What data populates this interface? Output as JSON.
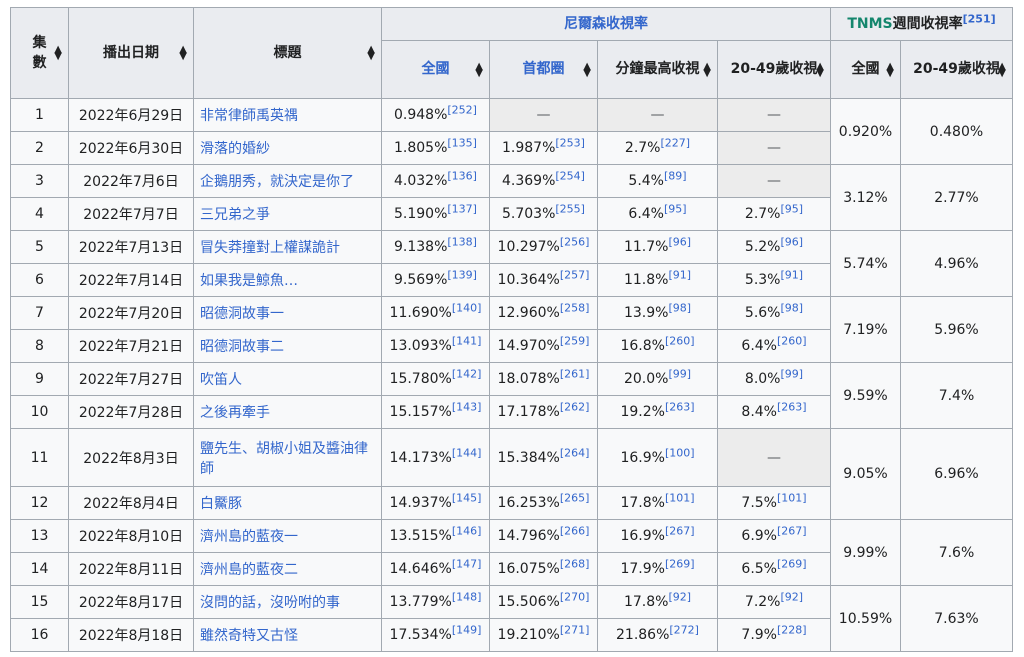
{
  "headers": {
    "ep": "集數",
    "date": "播出日期",
    "title": "標題",
    "nielsen_group": "尼爾森收視率",
    "tnms_group": "TNMS週間收視率",
    "tnms_ref": "[251]",
    "n_national": "全國",
    "n_capital": "首都圈",
    "n_peak": "分鐘最高收視",
    "n_2049": "20-49歲收視",
    "t_national": "全國",
    "t_2049": "20-49歲收視"
  },
  "rows": [
    {
      "ep": "1",
      "date": "2022年6月29日",
      "title": "非常律師禹英禑",
      "nat": "0.948%",
      "nat_ref": "[252]",
      "cap": "—",
      "cap_ref": "",
      "peak": "—",
      "peak_ref": "",
      "y2049": "—",
      "y2049_ref": ""
    },
    {
      "ep": "2",
      "date": "2022年6月30日",
      "title": "滑落的婚紗",
      "nat": "1.805%",
      "nat_ref": "[135]",
      "cap": "1.987%",
      "cap_ref": "[253]",
      "peak": "2.7%",
      "peak_ref": "[227]",
      "y2049": "—",
      "y2049_ref": ""
    },
    {
      "ep": "3",
      "date": "2022年7月6日",
      "title": "企鵝朋秀，就決定是你了",
      "nat": "4.032%",
      "nat_ref": "[136]",
      "cap": "4.369%",
      "cap_ref": "[254]",
      "peak": "5.4%",
      "peak_ref": "[89]",
      "y2049": "—",
      "y2049_ref": ""
    },
    {
      "ep": "4",
      "date": "2022年7月7日",
      "title": "三兄弟之爭",
      "nat": "5.190%",
      "nat_ref": "[137]",
      "cap": "5.703%",
      "cap_ref": "[255]",
      "peak": "6.4%",
      "peak_ref": "[95]",
      "y2049": "2.7%",
      "y2049_ref": "[95]"
    },
    {
      "ep": "5",
      "date": "2022年7月13日",
      "title": "冒失莽撞對上權謀詭計",
      "nat": "9.138%",
      "nat_ref": "[138]",
      "cap": "10.297%",
      "cap_ref": "[256]",
      "peak": "11.7%",
      "peak_ref": "[96]",
      "y2049": "5.2%",
      "y2049_ref": "[96]"
    },
    {
      "ep": "6",
      "date": "2022年7月14日",
      "title": "如果我是鯨魚…",
      "nat": "9.569%",
      "nat_ref": "[139]",
      "cap": "10.364%",
      "cap_ref": "[257]",
      "peak": "11.8%",
      "peak_ref": "[91]",
      "y2049": "5.3%",
      "y2049_ref": "[91]"
    },
    {
      "ep": "7",
      "date": "2022年7月20日",
      "title": "昭德洞故事一",
      "nat": "11.690%",
      "nat_ref": "[140]",
      "cap": "12.960%",
      "cap_ref": "[258]",
      "peak": "13.9%",
      "peak_ref": "[98]",
      "y2049": "5.6%",
      "y2049_ref": "[98]"
    },
    {
      "ep": "8",
      "date": "2022年7月21日",
      "title": "昭德洞故事二",
      "nat": "13.093%",
      "nat_ref": "[141]",
      "cap": "14.970%",
      "cap_ref": "[259]",
      "peak": "16.8%",
      "peak_ref": "[260]",
      "y2049": "6.4%",
      "y2049_ref": "[260]"
    },
    {
      "ep": "9",
      "date": "2022年7月27日",
      "title": "吹笛人",
      "nat": "15.780%",
      "nat_ref": "[142]",
      "cap": "18.078%",
      "cap_ref": "[261]",
      "peak": "20.0%",
      "peak_ref": "[99]",
      "y2049": "8.0%",
      "y2049_ref": "[99]"
    },
    {
      "ep": "10",
      "date": "2022年7月28日",
      "title": "之後再牽手",
      "nat": "15.157%",
      "nat_ref": "[143]",
      "cap": "17.178%",
      "cap_ref": "[262]",
      "peak": "19.2%",
      "peak_ref": "[263]",
      "y2049": "8.4%",
      "y2049_ref": "[263]"
    },
    {
      "ep": "11",
      "date": "2022年8月3日",
      "title": "鹽先生、胡椒小姐及醬油律師",
      "nat": "14.173%",
      "nat_ref": "[144]",
      "cap": "15.384%",
      "cap_ref": "[264]",
      "peak": "16.9%",
      "peak_ref": "[100]",
      "y2049": "—",
      "y2049_ref": ""
    },
    {
      "ep": "12",
      "date": "2022年8月4日",
      "title": "白鱀豚",
      "nat": "14.937%",
      "nat_ref": "[145]",
      "cap": "16.253%",
      "cap_ref": "[265]",
      "peak": "17.8%",
      "peak_ref": "[101]",
      "y2049": "7.5%",
      "y2049_ref": "[101]"
    },
    {
      "ep": "13",
      "date": "2022年8月10日",
      "title": "濟州島的藍夜一",
      "nat": "13.515%",
      "nat_ref": "[146]",
      "cap": "14.796%",
      "cap_ref": "[266]",
      "peak": "16.9%",
      "peak_ref": "[267]",
      "y2049": "6.9%",
      "y2049_ref": "[267]"
    },
    {
      "ep": "14",
      "date": "2022年8月11日",
      "title": "濟州島的藍夜二",
      "nat": "14.646%",
      "nat_ref": "[147]",
      "cap": "16.075%",
      "cap_ref": "[268]",
      "peak": "17.9%",
      "peak_ref": "[269]",
      "y2049": "6.5%",
      "y2049_ref": "[269]"
    },
    {
      "ep": "15",
      "date": "2022年8月17日",
      "title": "沒問的話，沒吩咐的事",
      "nat": "13.779%",
      "nat_ref": "[148]",
      "cap": "15.506%",
      "cap_ref": "[270]",
      "peak": "17.8%",
      "peak_ref": "[92]",
      "y2049": "7.2%",
      "y2049_ref": "[92]"
    },
    {
      "ep": "16",
      "date": "2022年8月18日",
      "title": "雖然奇特又古怪",
      "nat": "17.534%",
      "nat_ref": "[149]",
      "cap": "19.210%",
      "cap_ref": "[271]",
      "peak": "21.86%",
      "peak_ref": "[272]",
      "y2049": "7.9%",
      "y2049_ref": "[228]"
    }
  ],
  "weekly": [
    {
      "nat": "0.920%",
      "y2049": "0.480%"
    },
    {
      "nat": "3.12%",
      "y2049": "2.77%"
    },
    {
      "nat": "5.74%",
      "y2049": "4.96%"
    },
    {
      "nat": "7.19%",
      "y2049": "5.96%"
    },
    {
      "nat": "9.59%",
      "y2049": "7.4%"
    },
    {
      "nat": "9.05%",
      "y2049": "6.96%"
    },
    {
      "nat": "9.99%",
      "y2049": "7.6%"
    },
    {
      "nat": "10.59%",
      "y2049": "7.63%"
    }
  ]
}
